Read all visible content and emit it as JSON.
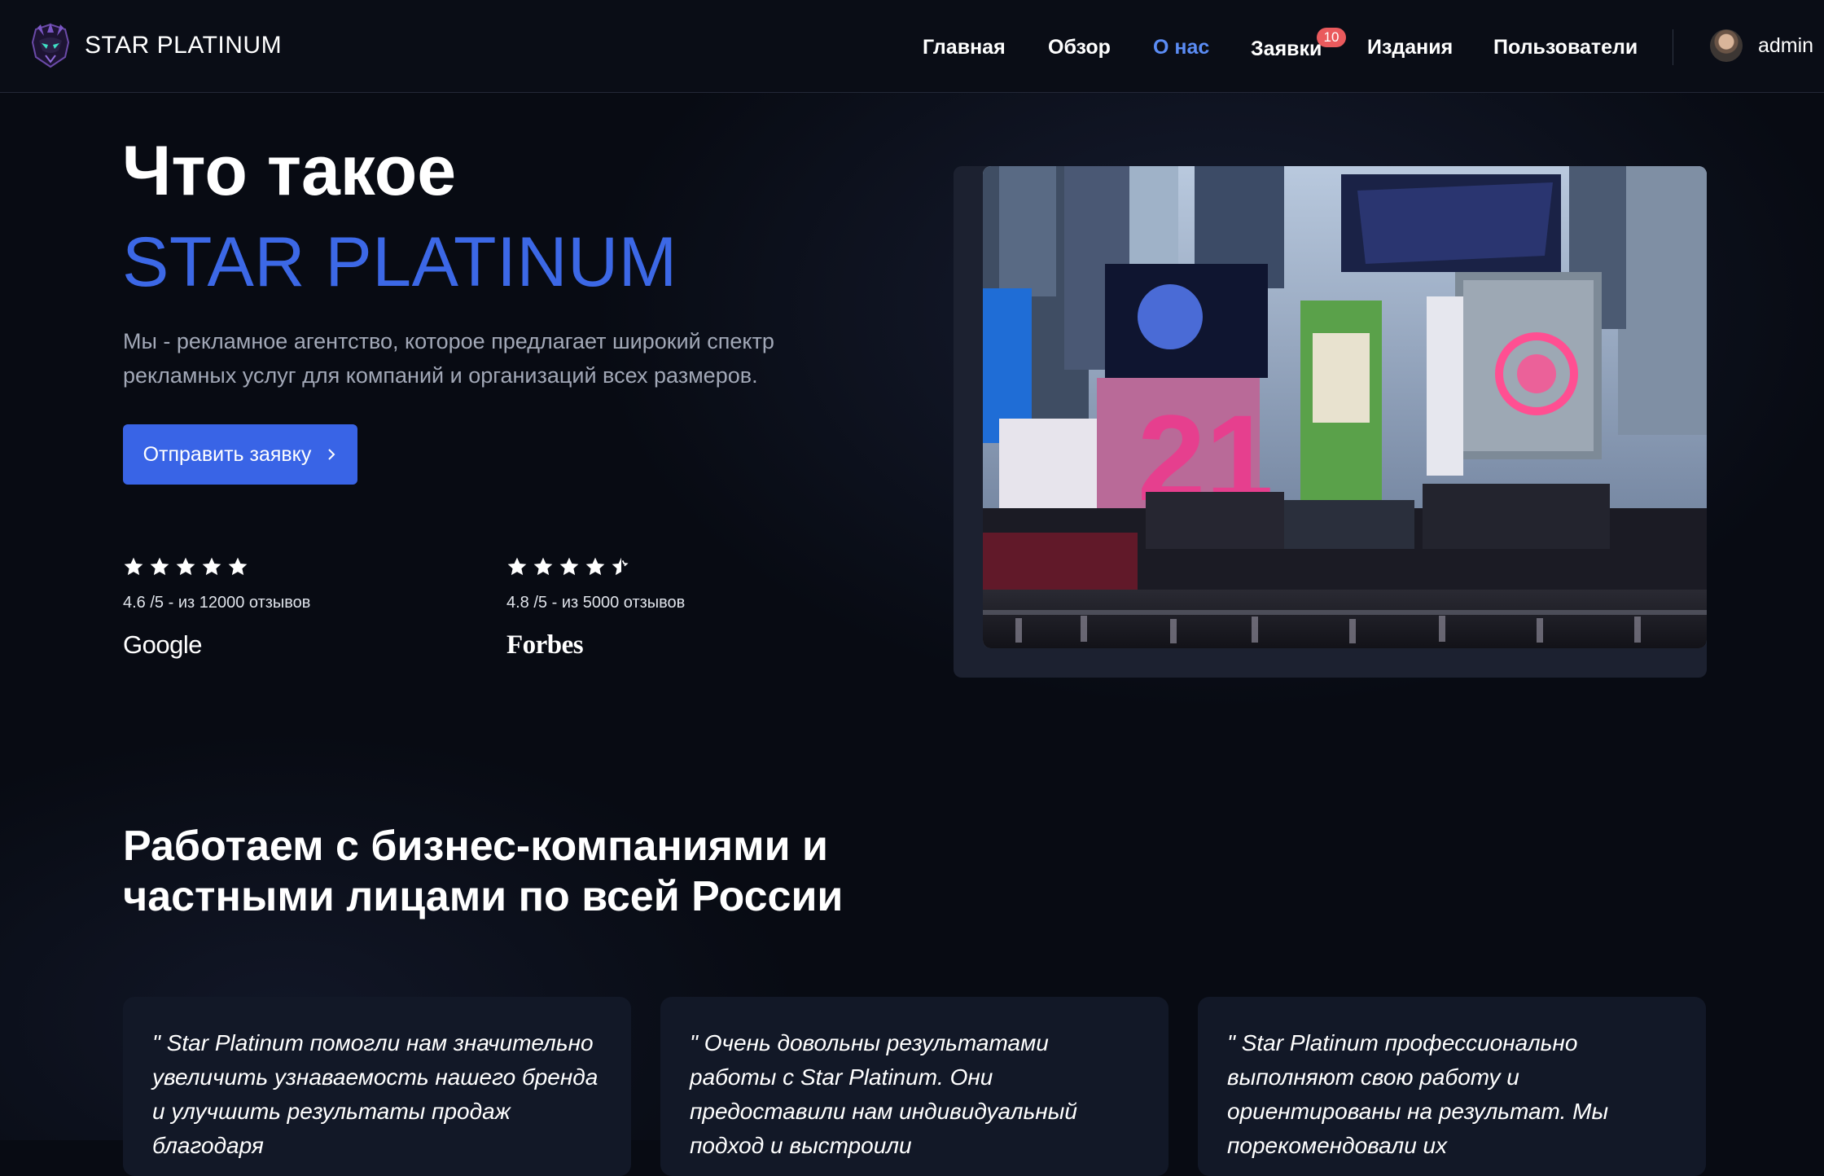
{
  "brand": {
    "name": "STAR PLATINUM",
    "logo_icon": "star-platinum-logo"
  },
  "nav": {
    "items": [
      {
        "label": "Главная",
        "active": false
      },
      {
        "label": "Обзор",
        "active": false
      },
      {
        "label": "О нас",
        "active": true
      },
      {
        "label": "Заявки",
        "active": false,
        "badge": "10"
      },
      {
        "label": "Издания",
        "active": false
      },
      {
        "label": "Пользователи",
        "active": false
      }
    ],
    "active_color": "#5b8cf5",
    "badge_color": "#ea5a5d"
  },
  "user": {
    "name": "admin",
    "avatar_icon": "user-avatar"
  },
  "hero": {
    "title_line1": "Что такое",
    "title_line2": "STAR PLATINUM",
    "title_accent_color": "#3c68e6",
    "description": "Мы - рекламное агентство, которое предлагает широкий спектр рекламных услуг для компаний и организаций всех размеров.",
    "cta_label": "Отправить заявку",
    "cta_icon": "chevron-right-icon",
    "cta_color": "#3964e6"
  },
  "ratings": [
    {
      "stars": 5,
      "text": "4.6 /5 - из 12000 отзывов",
      "brand": "Google"
    },
    {
      "stars": 4.5,
      "text": "4.8 /5 - из 5000 отзывов",
      "brand": "Forbes"
    }
  ],
  "section": {
    "title": "Работаем с бизнес-компаниями и частными лицами по всей России"
  },
  "testimonials": [
    {
      "text": "\" Star Platinum помогли нам значительно увеличить узнаваемость нашего бренда и улучшить результаты продаж благодаря"
    },
    {
      "text": "\" Очень довольны результатами работы с Star Platinum. Они предоставили нам индивидуальный подход и выстроили"
    },
    {
      "text": "\" Star Platinum профессионально выполняют свою работу и ориентированы на результат. Мы порекомендовали их"
    }
  ]
}
